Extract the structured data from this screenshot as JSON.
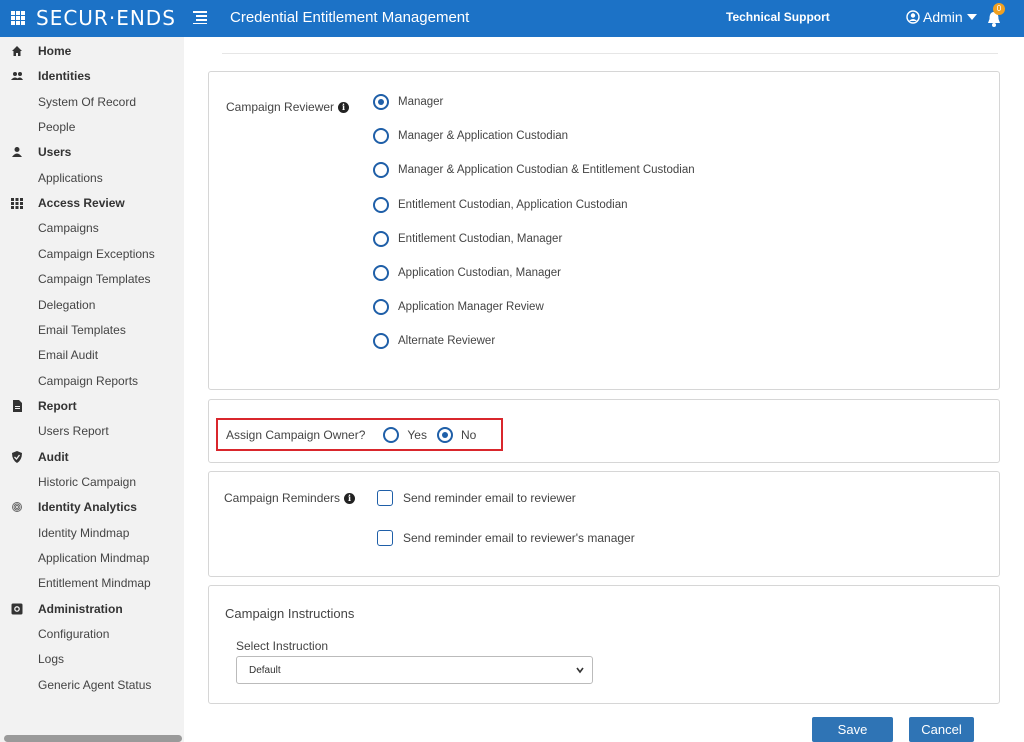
{
  "header": {
    "logo": "SECUR·ENDS",
    "app_title": "Credential Entitlement Management",
    "support": "Technical Support",
    "user": "Admin",
    "notification_count": "0"
  },
  "sidebar": {
    "items": [
      {
        "label": "Home",
        "section": true,
        "icon": "home-icon"
      },
      {
        "label": "Identities",
        "section": true,
        "icon": "users-group-icon"
      },
      {
        "label": "System Of Record",
        "section": false
      },
      {
        "label": "People",
        "section": false
      },
      {
        "label": "Users",
        "section": true,
        "icon": "user-icon"
      },
      {
        "label": "Applications",
        "section": false
      },
      {
        "label": "Access Review",
        "section": true,
        "icon": "grid-icon"
      },
      {
        "label": "Campaigns",
        "section": false
      },
      {
        "label": "Campaign Exceptions",
        "section": false
      },
      {
        "label": "Campaign Templates",
        "section": false
      },
      {
        "label": "Delegation",
        "section": false
      },
      {
        "label": "Email Templates",
        "section": false
      },
      {
        "label": "Email Audit",
        "section": false
      },
      {
        "label": "Campaign Reports",
        "section": false
      },
      {
        "label": "Report",
        "section": true,
        "icon": "file-icon"
      },
      {
        "label": "Users Report",
        "section": false
      },
      {
        "label": "Audit",
        "section": true,
        "icon": "shield-icon"
      },
      {
        "label": "Historic Campaign",
        "section": false
      },
      {
        "label": "Identity Analytics",
        "section": true,
        "icon": "fingerprint-icon"
      },
      {
        "label": "Identity Mindmap",
        "section": false
      },
      {
        "label": "Application Mindmap",
        "section": false
      },
      {
        "label": "Entitlement Mindmap",
        "section": false
      },
      {
        "label": "Administration",
        "section": true,
        "icon": "gear-box-icon"
      },
      {
        "label": "Configuration",
        "section": false
      },
      {
        "label": "Logs",
        "section": false
      },
      {
        "label": "Generic Agent Status",
        "section": false
      }
    ]
  },
  "reviewer": {
    "label": "Campaign Reviewer",
    "selected": "Manager",
    "options": [
      "Manager",
      "Manager & Application Custodian",
      "Manager & Application Custodian & Entitlement Custodian",
      "Entitlement Custodian, Application Custodian",
      "Entitlement Custodian, Manager",
      "Application Custodian, Manager",
      "Application Manager Review",
      "Alternate Reviewer"
    ]
  },
  "owner": {
    "label": "Assign Campaign Owner?",
    "yes": "Yes",
    "no": "No",
    "selected": "No"
  },
  "reminders": {
    "label": "Campaign Reminders",
    "options": [
      "Send reminder email to reviewer",
      "Send reminder email to reviewer's manager"
    ]
  },
  "instructions": {
    "title": "Campaign Instructions",
    "select_label": "Select Instruction",
    "selected": "Default"
  },
  "actions": {
    "save": "Save",
    "cancel": "Cancel"
  }
}
